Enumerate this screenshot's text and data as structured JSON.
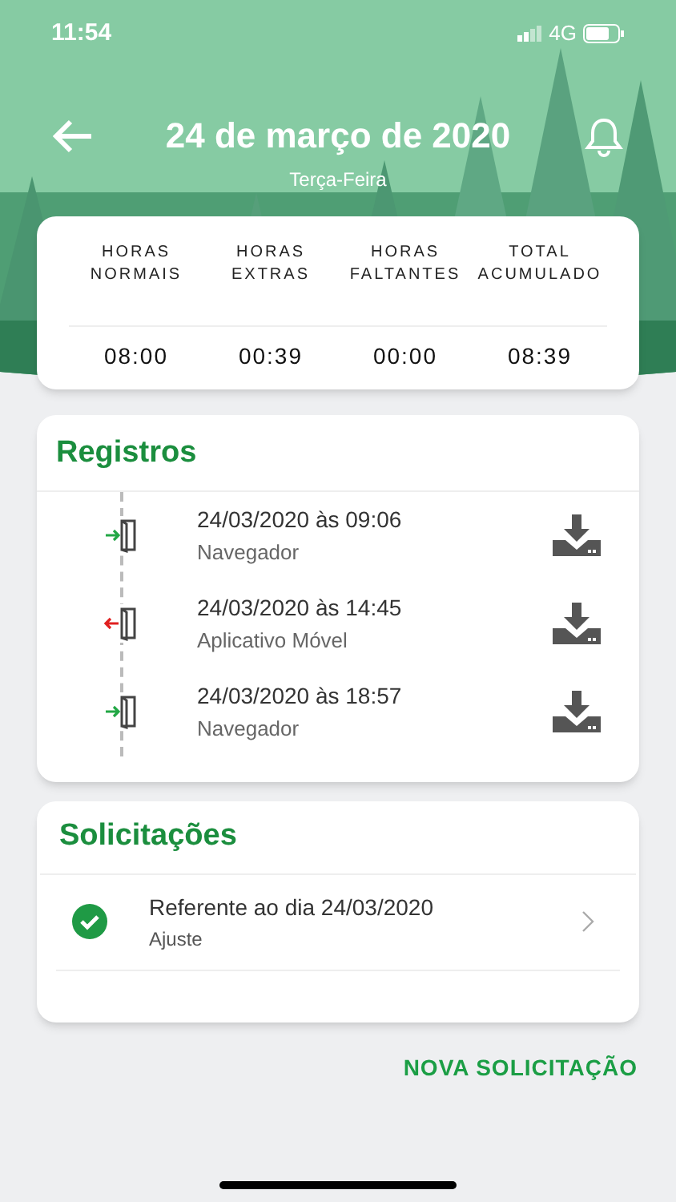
{
  "status_bar": {
    "time": "11:54",
    "network": "4G"
  },
  "header": {
    "title": "24 de março de 2020",
    "subtitle": "Terça-Feira"
  },
  "summary": [
    {
      "label": "HORAS NORMAIS",
      "value": "08:00"
    },
    {
      "label": "HORAS EXTRAS",
      "value": "00:39"
    },
    {
      "label": "HORAS FALTANTES",
      "value": "00:00"
    },
    {
      "label": "TOTAL ACUMULADO",
      "value": "08:39"
    }
  ],
  "registros": {
    "title": "Registros",
    "items": [
      {
        "kind": "in",
        "datetime": "24/03/2020 às 09:06",
        "source": "Navegador"
      },
      {
        "kind": "out",
        "datetime": "24/03/2020 às 14:45",
        "source": "Aplicativo Móvel"
      },
      {
        "kind": "in",
        "datetime": "24/03/2020 às 18:57",
        "source": "Navegador"
      }
    ]
  },
  "solicitacoes": {
    "title": "Solicitações",
    "items": [
      {
        "kind": "approved",
        "title": "Referente ao dia 24/03/2020",
        "type": "Ajuste"
      }
    ]
  },
  "new_request_button": "NOVA SOLICITAÇÃO"
}
